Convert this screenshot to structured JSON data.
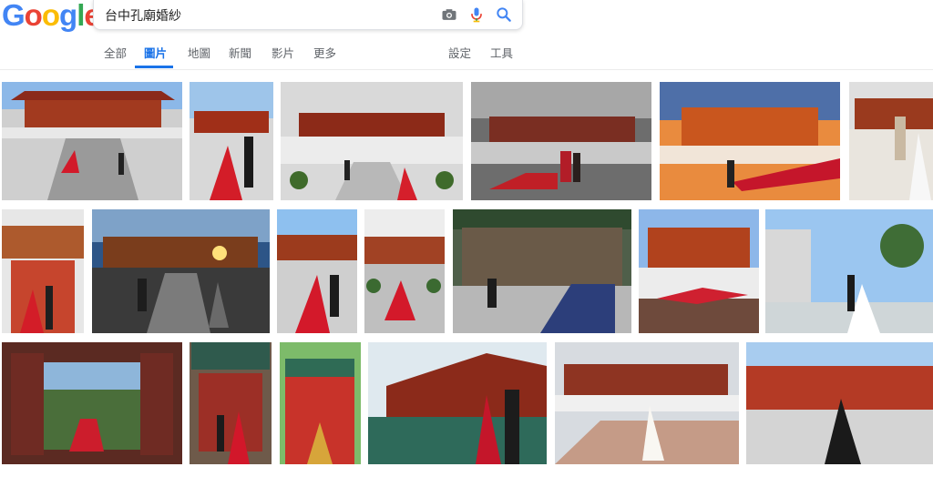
{
  "search": {
    "query": "台中孔廟婚紗"
  },
  "nav": {
    "tabs": [
      {
        "label": "全部"
      },
      {
        "label": "圖片"
      },
      {
        "label": "地圖"
      },
      {
        "label": "新聞"
      },
      {
        "label": "影片"
      },
      {
        "label": "更多"
      }
    ],
    "settings_label": "設定",
    "tools_label": "工具",
    "active_tab": "圖片"
  },
  "colors": {
    "accent": "#1a73e8",
    "logo_blue": "#4285f4",
    "logo_red": "#ea4335",
    "logo_yellow": "#fbbc05",
    "logo_green": "#34a853"
  },
  "icons": {
    "camera": "camera-icon",
    "mic": "mic-icon",
    "search": "search-icon"
  }
}
